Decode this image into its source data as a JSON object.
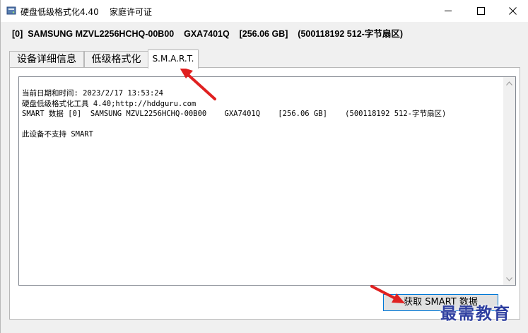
{
  "window": {
    "title": "硬盘低级格式化4.40    家庭许可证",
    "controls": {
      "minimize": "—",
      "maximize": "☐",
      "close": "✕"
    }
  },
  "device_info": "[0]  SAMSUNG MZVL2256HCHQ-00B00    GXA7401Q    [256.06 GB]    (500118192 512-字节扇区)",
  "tabs": [
    {
      "label": "设备详细信息",
      "active": false
    },
    {
      "label": "低级格式化",
      "active": false
    },
    {
      "label": "S.M.A.R.T.",
      "active": true
    }
  ],
  "smart_panel": {
    "lines": [
      "当前日期和时间: 2023/2/17 13:53:24",
      "硬盘低级格式化工具 4.40;http://hddguru.com",
      "SMART 数据 [0]  SAMSUNG MZVL2256HCHQ-00B00    GXA7401Q    [256.06 GB]    (500118192 512-字节扇区)",
      "",
      "此设备不支持 SMART"
    ],
    "button_label": "获取 SMART 数据"
  },
  "annotation_color": "#e02020",
  "watermark": "最需教育"
}
